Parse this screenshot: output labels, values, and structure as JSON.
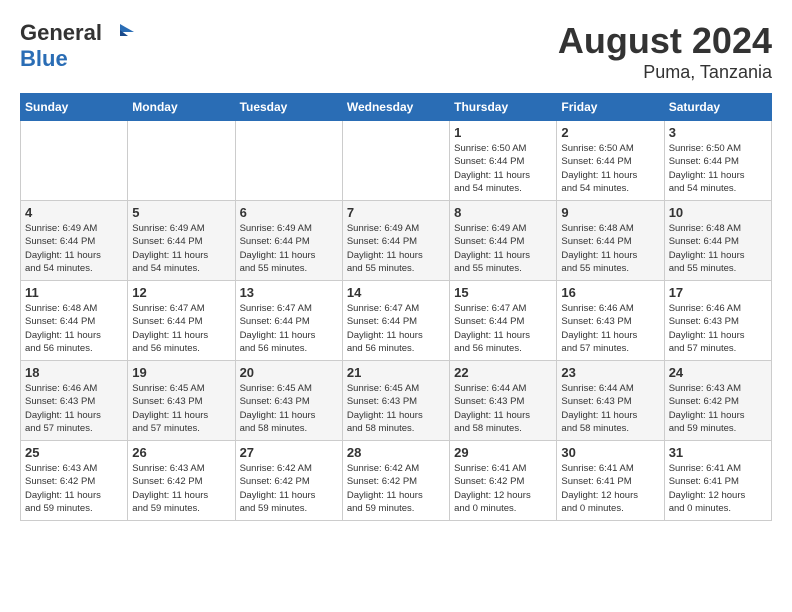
{
  "header": {
    "logo_general": "General",
    "logo_blue": "Blue",
    "month_title": "August 2024",
    "location": "Puma, Tanzania"
  },
  "days_of_week": [
    "Sunday",
    "Monday",
    "Tuesday",
    "Wednesday",
    "Thursday",
    "Friday",
    "Saturday"
  ],
  "weeks": [
    [
      {
        "day": "",
        "info": ""
      },
      {
        "day": "",
        "info": ""
      },
      {
        "day": "",
        "info": ""
      },
      {
        "day": "",
        "info": ""
      },
      {
        "day": "1",
        "info": "Sunrise: 6:50 AM\nSunset: 6:44 PM\nDaylight: 11 hours\nand 54 minutes."
      },
      {
        "day": "2",
        "info": "Sunrise: 6:50 AM\nSunset: 6:44 PM\nDaylight: 11 hours\nand 54 minutes."
      },
      {
        "day": "3",
        "info": "Sunrise: 6:50 AM\nSunset: 6:44 PM\nDaylight: 11 hours\nand 54 minutes."
      }
    ],
    [
      {
        "day": "4",
        "info": "Sunrise: 6:49 AM\nSunset: 6:44 PM\nDaylight: 11 hours\nand 54 minutes."
      },
      {
        "day": "5",
        "info": "Sunrise: 6:49 AM\nSunset: 6:44 PM\nDaylight: 11 hours\nand 54 minutes."
      },
      {
        "day": "6",
        "info": "Sunrise: 6:49 AM\nSunset: 6:44 PM\nDaylight: 11 hours\nand 55 minutes."
      },
      {
        "day": "7",
        "info": "Sunrise: 6:49 AM\nSunset: 6:44 PM\nDaylight: 11 hours\nand 55 minutes."
      },
      {
        "day": "8",
        "info": "Sunrise: 6:49 AM\nSunset: 6:44 PM\nDaylight: 11 hours\nand 55 minutes."
      },
      {
        "day": "9",
        "info": "Sunrise: 6:48 AM\nSunset: 6:44 PM\nDaylight: 11 hours\nand 55 minutes."
      },
      {
        "day": "10",
        "info": "Sunrise: 6:48 AM\nSunset: 6:44 PM\nDaylight: 11 hours\nand 55 minutes."
      }
    ],
    [
      {
        "day": "11",
        "info": "Sunrise: 6:48 AM\nSunset: 6:44 PM\nDaylight: 11 hours\nand 56 minutes."
      },
      {
        "day": "12",
        "info": "Sunrise: 6:47 AM\nSunset: 6:44 PM\nDaylight: 11 hours\nand 56 minutes."
      },
      {
        "day": "13",
        "info": "Sunrise: 6:47 AM\nSunset: 6:44 PM\nDaylight: 11 hours\nand 56 minutes."
      },
      {
        "day": "14",
        "info": "Sunrise: 6:47 AM\nSunset: 6:44 PM\nDaylight: 11 hours\nand 56 minutes."
      },
      {
        "day": "15",
        "info": "Sunrise: 6:47 AM\nSunset: 6:44 PM\nDaylight: 11 hours\nand 56 minutes."
      },
      {
        "day": "16",
        "info": "Sunrise: 6:46 AM\nSunset: 6:43 PM\nDaylight: 11 hours\nand 57 minutes."
      },
      {
        "day": "17",
        "info": "Sunrise: 6:46 AM\nSunset: 6:43 PM\nDaylight: 11 hours\nand 57 minutes."
      }
    ],
    [
      {
        "day": "18",
        "info": "Sunrise: 6:46 AM\nSunset: 6:43 PM\nDaylight: 11 hours\nand 57 minutes."
      },
      {
        "day": "19",
        "info": "Sunrise: 6:45 AM\nSunset: 6:43 PM\nDaylight: 11 hours\nand 57 minutes."
      },
      {
        "day": "20",
        "info": "Sunrise: 6:45 AM\nSunset: 6:43 PM\nDaylight: 11 hours\nand 58 minutes."
      },
      {
        "day": "21",
        "info": "Sunrise: 6:45 AM\nSunset: 6:43 PM\nDaylight: 11 hours\nand 58 minutes."
      },
      {
        "day": "22",
        "info": "Sunrise: 6:44 AM\nSunset: 6:43 PM\nDaylight: 11 hours\nand 58 minutes."
      },
      {
        "day": "23",
        "info": "Sunrise: 6:44 AM\nSunset: 6:43 PM\nDaylight: 11 hours\nand 58 minutes."
      },
      {
        "day": "24",
        "info": "Sunrise: 6:43 AM\nSunset: 6:42 PM\nDaylight: 11 hours\nand 59 minutes."
      }
    ],
    [
      {
        "day": "25",
        "info": "Sunrise: 6:43 AM\nSunset: 6:42 PM\nDaylight: 11 hours\nand 59 minutes."
      },
      {
        "day": "26",
        "info": "Sunrise: 6:43 AM\nSunset: 6:42 PM\nDaylight: 11 hours\nand 59 minutes."
      },
      {
        "day": "27",
        "info": "Sunrise: 6:42 AM\nSunset: 6:42 PM\nDaylight: 11 hours\nand 59 minutes."
      },
      {
        "day": "28",
        "info": "Sunrise: 6:42 AM\nSunset: 6:42 PM\nDaylight: 11 hours\nand 59 minutes."
      },
      {
        "day": "29",
        "info": "Sunrise: 6:41 AM\nSunset: 6:42 PM\nDaylight: 12 hours\nand 0 minutes."
      },
      {
        "day": "30",
        "info": "Sunrise: 6:41 AM\nSunset: 6:41 PM\nDaylight: 12 hours\nand 0 minutes."
      },
      {
        "day": "31",
        "info": "Sunrise: 6:41 AM\nSunset: 6:41 PM\nDaylight: 12 hours\nand 0 minutes."
      }
    ]
  ]
}
